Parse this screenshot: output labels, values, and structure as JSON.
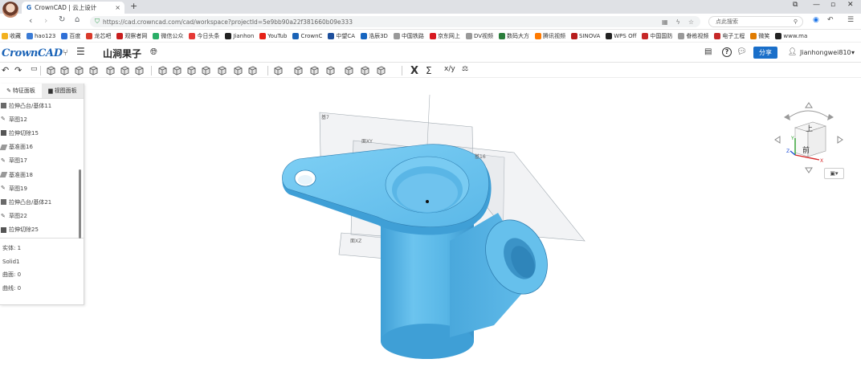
{
  "browser": {
    "tab_title": "CrownCAD | 云上设计",
    "tab_close": "×",
    "new_tab": "+",
    "url": "https://cad.crowncad.com/cad/workspace?projectId=5e9bb90a22f381660b09e333",
    "search_placeholder": "点此搜索",
    "window_controls": [
      "⧉",
      "—",
      "▫",
      "✕"
    ]
  },
  "bookmarks": [
    {
      "label": "收藏",
      "color": "#f2b01e"
    },
    {
      "label": "hao123",
      "color": "#3a7bd5"
    },
    {
      "label": "百度",
      "color": "#2f6fd6"
    },
    {
      "label": "龙芯吧",
      "color": "#d93a2b"
    },
    {
      "label": "观察者网",
      "color": "#c81e1e"
    },
    {
      "label": "微信公众",
      "color": "#2aae67"
    },
    {
      "label": "今日头条",
      "color": "#e53935"
    },
    {
      "label": "Jianhon",
      "color": "#222222"
    },
    {
      "label": "YouTub",
      "color": "#e62117"
    },
    {
      "label": "CrownC",
      "color": "#1a63b7"
    },
    {
      "label": "中望CA",
      "color": "#1d4f9c"
    },
    {
      "label": "浩辰3D",
      "color": "#1565c0"
    },
    {
      "label": "中国铁路",
      "color": "#999999"
    },
    {
      "label": "京东网上",
      "color": "#d71920"
    },
    {
      "label": "DV视频",
      "color": "#999999"
    },
    {
      "label": "数码大方",
      "color": "#2a7d3b"
    },
    {
      "label": "腾讯视频",
      "color": "#ff7a00"
    },
    {
      "label": "SINOVA",
      "color": "#b71c1c"
    },
    {
      "label": "WPS Off",
      "color": "#222222"
    },
    {
      "label": "中国国防",
      "color": "#c62828"
    },
    {
      "label": "眷栋视频",
      "color": "#999999"
    },
    {
      "label": "电子工程",
      "color": "#c62828"
    },
    {
      "label": "微笑",
      "color": "#e07b00"
    },
    {
      "label": "www.ma",
      "color": "#222222"
    }
  ],
  "app": {
    "logo": "CrownCAD",
    "project_title": "山涧果子",
    "share_label": "分享",
    "user_name": "Jianhongwei810",
    "user_caret": "▾"
  },
  "panel": {
    "tabs": [
      "特征面板",
      "视图面板"
    ],
    "features": [
      {
        "label": "拉伸凸台/基体11",
        "icon": "extrude-boss-icon"
      },
      {
        "label": "草图12",
        "icon": "sketch-icon"
      },
      {
        "label": "拉伸切除15",
        "icon": "extrude-cut-icon"
      },
      {
        "label": "基准面16",
        "icon": "plane-icon"
      },
      {
        "label": "草图17",
        "icon": "sketch-icon"
      },
      {
        "label": "基准面18",
        "icon": "plane-icon"
      },
      {
        "label": "草图19",
        "icon": "sketch-icon"
      },
      {
        "label": "拉伸凸台/基体21",
        "icon": "extrude-boss-icon"
      },
      {
        "label": "草图22",
        "icon": "sketch-icon"
      },
      {
        "label": "拉伸切除25",
        "icon": "extrude-cut-icon"
      }
    ],
    "stats": [
      "实体: 1",
      "Solid1",
      "曲面: 0",
      "曲线: 0"
    ]
  },
  "viewport": {
    "plane_labels": [
      "基7",
      "面XY",
      "基16",
      "面XZ"
    ],
    "cube_top": "上",
    "cube_front": "前",
    "axis_x": "X",
    "axis_y": "Y",
    "axis_z": "Z",
    "view_menu": "▾",
    "model_color": "#5bb8e8"
  }
}
